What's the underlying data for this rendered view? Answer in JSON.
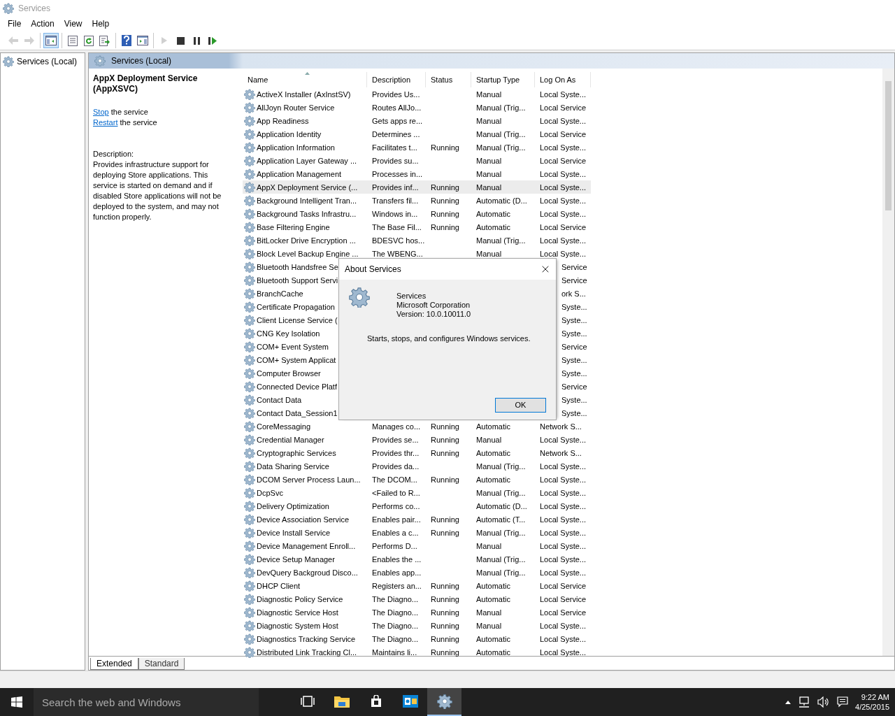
{
  "window": {
    "title": "Services"
  },
  "menu": [
    "File",
    "Action",
    "View",
    "Help"
  ],
  "toolbar": [
    [
      {
        "kind": "back",
        "disabled": true,
        "selected": false
      },
      {
        "kind": "forward",
        "disabled": true,
        "selected": false
      }
    ],
    [
      {
        "kind": "console-tree",
        "disabled": false,
        "selected": true
      }
    ],
    [
      {
        "kind": "properties",
        "disabled": false,
        "selected": false
      },
      {
        "kind": "refresh",
        "disabled": false,
        "selected": false
      },
      {
        "kind": "export",
        "disabled": false,
        "selected": false
      }
    ],
    [
      {
        "kind": "help",
        "disabled": false,
        "selected": false
      },
      {
        "kind": "action-pane",
        "disabled": false,
        "selected": false
      }
    ],
    [
      {
        "kind": "play",
        "disabled": true,
        "selected": false
      },
      {
        "kind": "stop",
        "disabled": false,
        "selected": false
      },
      {
        "kind": "pause",
        "disabled": false,
        "selected": false
      },
      {
        "kind": "resume",
        "disabled": false,
        "selected": false
      }
    ]
  ],
  "tree": {
    "items": [
      {
        "label": "Services (Local)",
        "selected": false
      }
    ]
  },
  "pane_header": "Services (Local)",
  "details": {
    "title": "AppX Deployment Service (AppXSVC)",
    "actions": [
      {
        "link": "Stop",
        "text": "the service"
      },
      {
        "link": "Restart",
        "text": "the service"
      }
    ],
    "description_label": "Description:",
    "description": "Provides infrastructure support for deploying Store applications. This service is started on demand and if disabled Store applications will not be deployed to the system, and may not function properly."
  },
  "table": {
    "columns": [
      {
        "label": "Name",
        "sorted": true
      },
      {
        "label": "Description",
        "sorted": false
      },
      {
        "label": "Status",
        "sorted": false
      },
      {
        "label": "Startup Type",
        "sorted": false
      },
      {
        "label": "Log On As",
        "sorted": false
      }
    ],
    "rows": [
      {
        "kind": "full",
        "selected": false,
        "name": "ActiveX Installer (AxInstSV)",
        "description": "Provides Us...",
        "startup": "Manual",
        "logon": "Local Syste..."
      },
      {
        "kind": "full",
        "selected": false,
        "name": "AllJoyn Router Service",
        "description": "Routes AllJo...",
        "startup": "Manual (Trig...",
        "logon": "Local Service"
      },
      {
        "kind": "full",
        "selected": false,
        "name": "App Readiness",
        "description": "Gets apps re...",
        "startup": "Manual",
        "logon": "Local Syste..."
      },
      {
        "kind": "full",
        "selected": false,
        "name": "Application Identity",
        "description": "Determines ...",
        "startup": "Manual (Trig...",
        "logon": "Local Service"
      },
      {
        "kind": "full",
        "selected": false,
        "name": "Application Information",
        "description": "Facilitates t...",
        "status": "Running",
        "startup": "Manual (Trig...",
        "logon": "Local Syste..."
      },
      {
        "kind": "full",
        "selected": false,
        "name": "Application Layer Gateway ...",
        "description": "Provides su...",
        "startup": "Manual",
        "logon": "Local Service"
      },
      {
        "kind": "full",
        "selected": false,
        "name": "Application Management",
        "description": "Processes in...",
        "startup": "Manual",
        "logon": "Local Syste..."
      },
      {
        "kind": "full",
        "selected": true,
        "name": "AppX Deployment Service (...",
        "description": "Provides inf...",
        "status": "Running",
        "startup": "Manual",
        "logon": "Local Syste..."
      },
      {
        "kind": "full",
        "selected": false,
        "name": "Background Intelligent Tran...",
        "description": "Transfers fil...",
        "status": "Running",
        "startup": "Automatic (D...",
        "logon": "Local Syste..."
      },
      {
        "kind": "full",
        "selected": false,
        "name": "Background Tasks Infrastru...",
        "description": "Windows in...",
        "status": "Running",
        "startup": "Automatic",
        "logon": "Local Syste..."
      },
      {
        "kind": "full",
        "selected": false,
        "name": "Base Filtering Engine",
        "description": "The Base Fil...",
        "status": "Running",
        "startup": "Automatic",
        "logon": "Local Service"
      },
      {
        "kind": "full",
        "selected": false,
        "name": "BitLocker Drive Encryption ...",
        "description": "BDESVC hos...",
        "startup": "Manual (Trig...",
        "logon": "Local Syste..."
      },
      {
        "kind": "full",
        "selected": false,
        "name": "Block Level Backup Engine ...",
        "description": "The WBENG...",
        "startup": "Manual",
        "logon": "Local Syste..."
      },
      {
        "kind": "covered",
        "selected": false,
        "name": "Bluetooth Handsfree Se",
        "logon": "Service"
      },
      {
        "kind": "covered",
        "selected": false,
        "name": "Bluetooth Support Servi",
        "logon": "Service"
      },
      {
        "kind": "covered",
        "selected": false,
        "name": "BranchCache",
        "logon": "ork S..."
      },
      {
        "kind": "covered",
        "selected": false,
        "name": "Certificate Propagation",
        "logon": "Syste..."
      },
      {
        "kind": "covered",
        "selected": false,
        "name": "Client License Service (",
        "logon": "Syste..."
      },
      {
        "kind": "covered",
        "selected": false,
        "name": "CNG Key Isolation",
        "logon": "Syste..."
      },
      {
        "kind": "covered",
        "selected": false,
        "name": "COM+ Event System",
        "logon": "Service"
      },
      {
        "kind": "covered",
        "selected": false,
        "name": "COM+ System Applicat",
        "logon": "Syste..."
      },
      {
        "kind": "covered",
        "selected": false,
        "name": "Computer Browser",
        "logon": "Syste..."
      },
      {
        "kind": "covered",
        "selected": false,
        "name": "Connected Device Platf",
        "logon": "Service"
      },
      {
        "kind": "covered",
        "selected": false,
        "name": "Contact Data",
        "logon": "Syste..."
      },
      {
        "kind": "covered",
        "selected": false,
        "name": "Contact Data_Session1",
        "logon": "Syste..."
      },
      {
        "kind": "full",
        "selected": false,
        "name": "CoreMessaging",
        "description": "Manages co...",
        "status": "Running",
        "startup": "Automatic",
        "logon": "Network S..."
      },
      {
        "kind": "full",
        "selected": false,
        "name": "Credential Manager",
        "description": "Provides se...",
        "status": "Running",
        "startup": "Manual",
        "logon": "Local Syste..."
      },
      {
        "kind": "full",
        "selected": false,
        "name": "Cryptographic Services",
        "description": "Provides thr...",
        "status": "Running",
        "startup": "Automatic",
        "logon": "Network S..."
      },
      {
        "kind": "full",
        "selected": false,
        "name": "Data Sharing Service",
        "description": "Provides da...",
        "startup": "Manual (Trig...",
        "logon": "Local Syste..."
      },
      {
        "kind": "full",
        "selected": false,
        "name": "DCOM Server Process Laun...",
        "description": "The DCOM...",
        "status": "Running",
        "startup": "Automatic",
        "logon": "Local Syste..."
      },
      {
        "kind": "full",
        "selected": false,
        "name": "DcpSvc",
        "description": "<Failed to R...",
        "startup": "Manual (Trig...",
        "logon": "Local Syste..."
      },
      {
        "kind": "full",
        "selected": false,
        "name": "Delivery Optimization",
        "description": "Performs co...",
        "startup": "Automatic (D...",
        "logon": "Local Syste..."
      },
      {
        "kind": "full",
        "selected": false,
        "name": "Device Association Service",
        "description": "Enables pair...",
        "status": "Running",
        "startup": "Automatic (T...",
        "logon": "Local Syste..."
      },
      {
        "kind": "full",
        "selected": false,
        "name": "Device Install Service",
        "description": "Enables a c...",
        "status": "Running",
        "startup": "Manual (Trig...",
        "logon": "Local Syste..."
      },
      {
        "kind": "full",
        "selected": false,
        "name": "Device Management Enroll...",
        "description": "Performs D...",
        "startup": "Manual",
        "logon": "Local Syste..."
      },
      {
        "kind": "full",
        "selected": false,
        "name": "Device Setup Manager",
        "description": "Enables the ...",
        "startup": "Manual (Trig...",
        "logon": "Local Syste..."
      },
      {
        "kind": "full",
        "selected": false,
        "name": "DevQuery Backgroud Disco...",
        "description": "Enables app...",
        "startup": "Manual (Trig...",
        "logon": "Local Syste..."
      },
      {
        "kind": "full",
        "selected": false,
        "name": "DHCP Client",
        "description": "Registers an...",
        "status": "Running",
        "startup": "Automatic",
        "logon": "Local Service"
      },
      {
        "kind": "full",
        "selected": false,
        "name": "Diagnostic Policy Service",
        "description": "The Diagno...",
        "status": "Running",
        "startup": "Automatic",
        "logon": "Local Service"
      },
      {
        "kind": "full",
        "selected": false,
        "name": "Diagnostic Service Host",
        "description": "The Diagno...",
        "status": "Running",
        "startup": "Manual",
        "logon": "Local Service"
      },
      {
        "kind": "full",
        "selected": false,
        "name": "Diagnostic System Host",
        "description": "The Diagno...",
        "status": "Running",
        "startup": "Manual",
        "logon": "Local Syste..."
      },
      {
        "kind": "full",
        "selected": false,
        "name": "Diagnostics Tracking Service",
        "description": "The Diagno...",
        "status": "Running",
        "startup": "Automatic",
        "logon": "Local Syste..."
      },
      {
        "kind": "full",
        "selected": false,
        "name": "Distributed Link Tracking Cl...",
        "description": "Maintains li...",
        "status": "Running",
        "startup": "Automatic",
        "logon": "Local Syste..."
      }
    ]
  },
  "view_tabs": [
    {
      "label": "Extended",
      "selected": true
    },
    {
      "label": "Standard",
      "selected": false
    }
  ],
  "dialog": {
    "title": "About Services",
    "product": "Services",
    "company": "Microsoft Corporation",
    "version": "Version: 10.0.10011.0",
    "description": "Starts, stops, and configures Windows services.",
    "button": "OK"
  },
  "taskbar": {
    "search_placeholder": "Search the web and Windows",
    "apps": [
      {
        "kind": "task-view",
        "active": false
      },
      {
        "kind": "folder",
        "active": false
      },
      {
        "kind": "store",
        "active": false
      },
      {
        "kind": "mail",
        "active": false
      },
      {
        "kind": "services",
        "active": true
      }
    ],
    "time": "9:22 AM",
    "date": "4/25/2015"
  }
}
